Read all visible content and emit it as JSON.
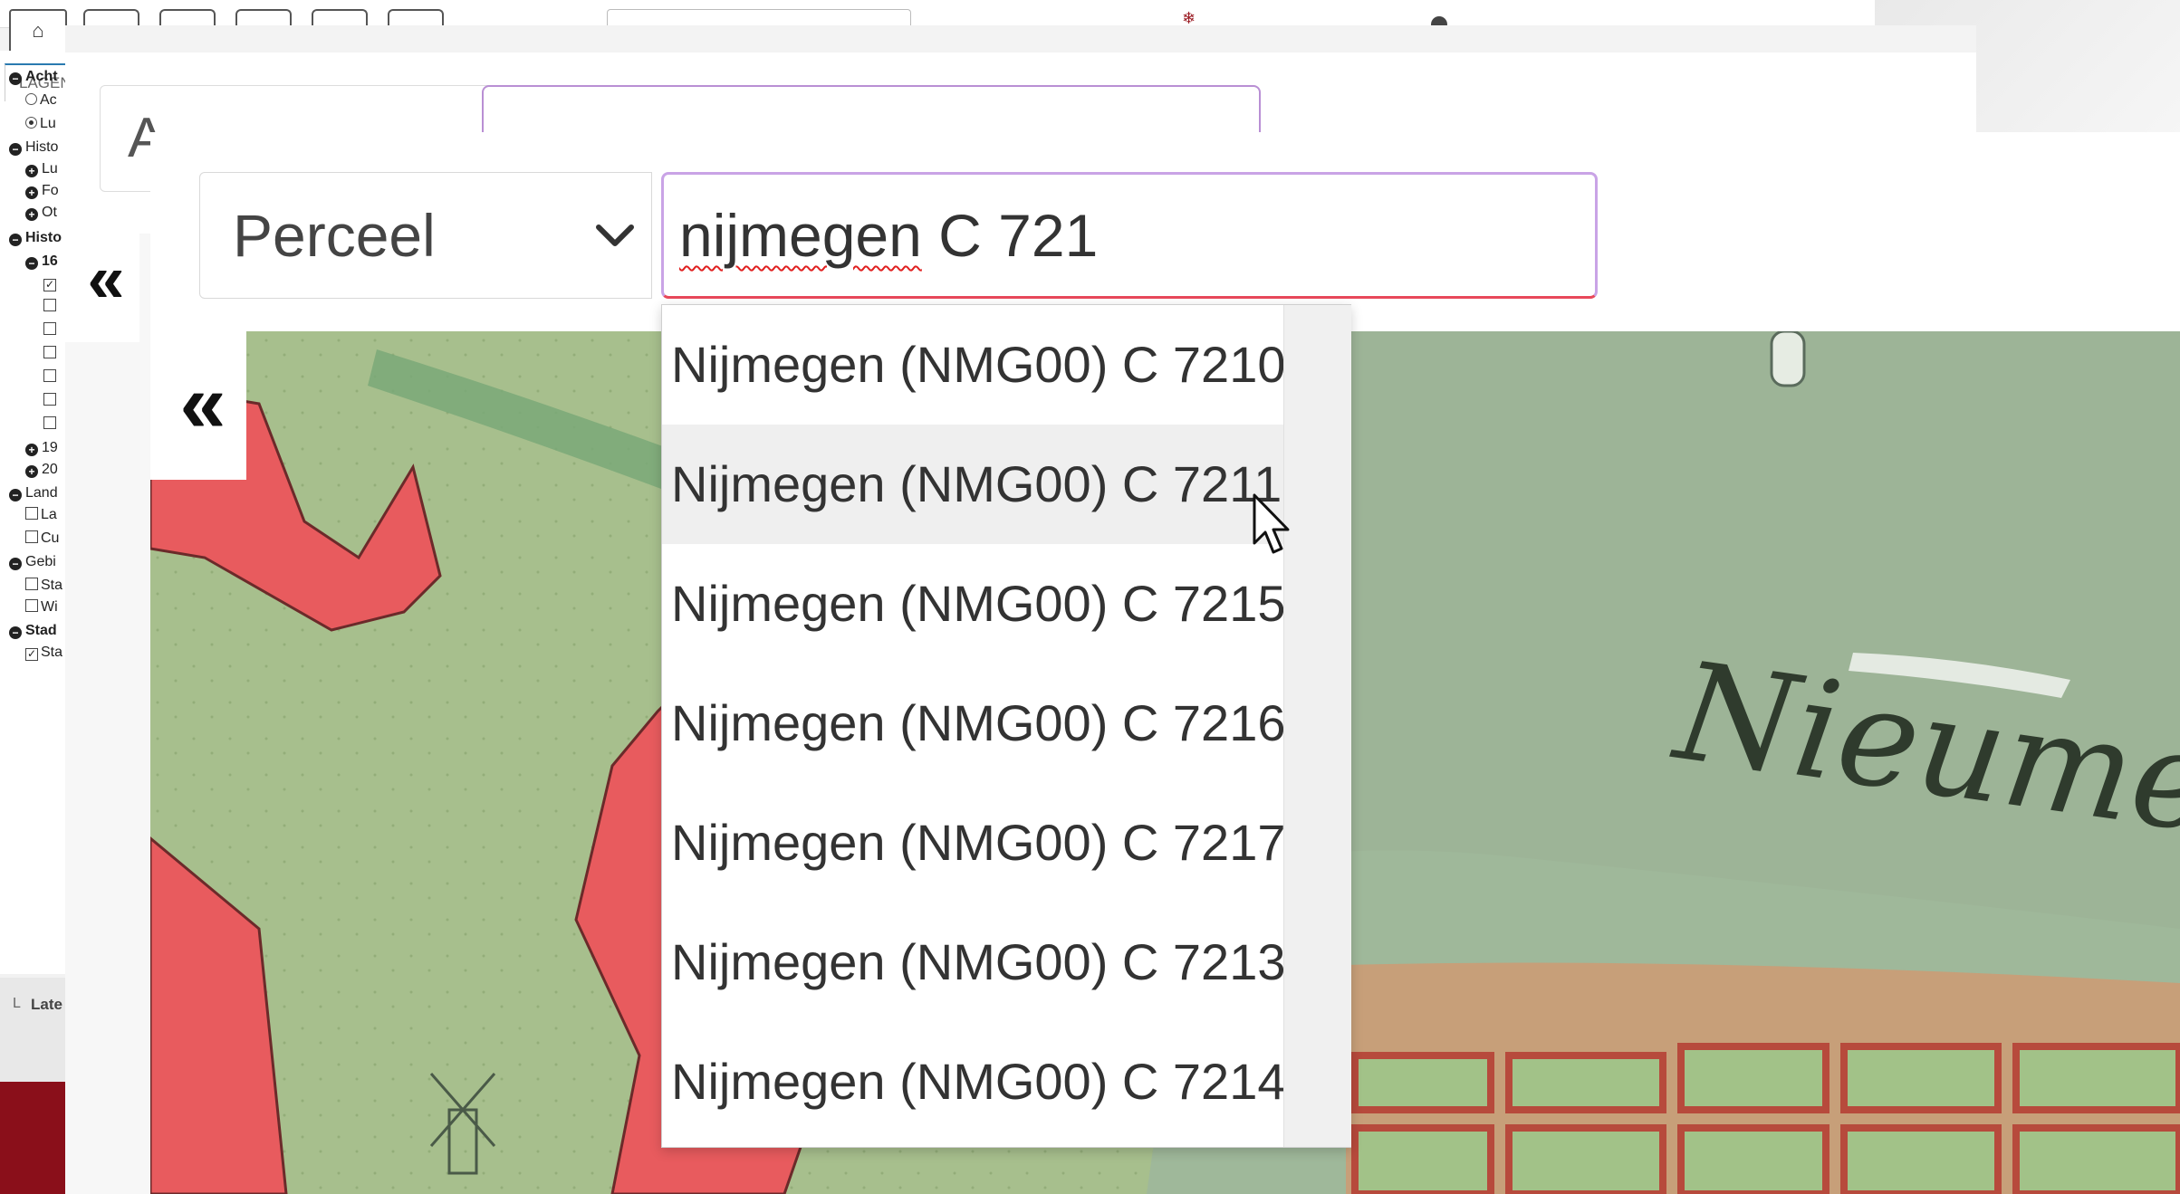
{
  "background_app": {
    "sidebar_tab": "LAGEN",
    "tree": [
      {
        "label": "Acht",
        "icon": "minus",
        "bold": true
      },
      {
        "label": "Ac",
        "control": "radio",
        "checked": false
      },
      {
        "label": "Lu",
        "control": "radio",
        "checked": true
      },
      {
        "label": "Histo",
        "icon": "minus",
        "bold": false
      },
      {
        "label": "Lu",
        "icon": "plus"
      },
      {
        "label": "Fo",
        "icon": "plus"
      },
      {
        "label": "Ot",
        "icon": "plus"
      },
      {
        "label": "Histo",
        "icon": "minus",
        "bold": true
      },
      {
        "label": "16",
        "icon": "minus",
        "bold": true
      },
      {
        "label": "",
        "control": "check",
        "checked": true
      },
      {
        "label": "",
        "control": "check",
        "checked": false
      },
      {
        "label": "",
        "control": "check",
        "checked": false
      },
      {
        "label": "",
        "control": "check",
        "checked": false
      },
      {
        "label": "",
        "control": "check",
        "checked": false
      },
      {
        "label": "",
        "control": "check",
        "checked": false
      },
      {
        "label": "",
        "control": "check",
        "checked": false
      },
      {
        "label": "19",
        "icon": "plus"
      },
      {
        "label": "20",
        "icon": "plus"
      },
      {
        "label": "Land",
        "icon": "minus",
        "bold": false
      },
      {
        "label": "La",
        "control": "check",
        "checked": false
      },
      {
        "label": "Cu",
        "control": "check",
        "checked": false
      },
      {
        "label": "Gebi",
        "icon": "minus",
        "bold": false
      },
      {
        "label": "Sta",
        "control": "check",
        "checked": false
      },
      {
        "label": "Wi",
        "control": "check",
        "checked": false
      },
      {
        "label": "Stad",
        "icon": "minus",
        "bold": true
      },
      {
        "label": "Sta",
        "control": "check",
        "checked": true
      }
    ],
    "footer_label": "Late",
    "footer_letter": "L",
    "mid_select_letter": "A"
  },
  "search": {
    "layer_select_value": "Perceel",
    "query_misspelled": "nijmegen",
    "query_rest": " C 721",
    "query_full": "nijmegen C 721"
  },
  "autocomplete": {
    "items": [
      "Nijmegen (NMG00) C 7210",
      "Nijmegen (NMG00) C 7211",
      "Nijmegen (NMG00) C 7215",
      "Nijmegen (NMG00) C 7216",
      "Nijmegen (NMG00) C 7217",
      "Nijmegen (NMG00) C 7213",
      "Nijmegen (NMG00) C 7214"
    ],
    "hovered_index": 1
  },
  "map": {
    "label": "Nieume",
    "colors": {
      "water": "#9fb89a",
      "land": "#a9c08e",
      "parcel_highlight": "#e85b5e",
      "town_block": "#c9a07a"
    }
  },
  "icons": {
    "home": "home-icon",
    "collapse": "double-chevron-left-icon",
    "dropdown": "chevron-down-icon",
    "cursor": "mouse-pointer-icon"
  }
}
